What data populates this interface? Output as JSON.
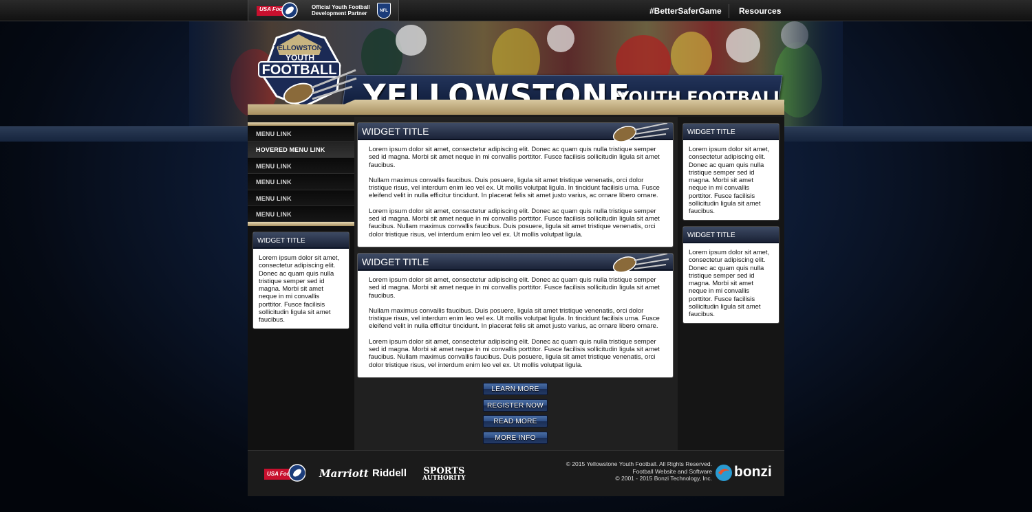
{
  "topbar": {
    "usa_logo_label": "USA Football",
    "partner_line1": "Official Youth Football",
    "partner_line2": "Development Partner",
    "nfl_label": "NFL",
    "hashtag": "#BetterSaferGame",
    "resources": "Resources"
  },
  "header": {
    "logo_top": "YELLOWSTONE",
    "logo_mid": "YOUTH",
    "logo_bottom": "FOOTBALL",
    "title_big": "YELLOWSTONE",
    "title_small": "YOUTH FOOTBALL"
  },
  "menu": {
    "items": [
      "MENU LINK",
      "HOVERED MENU LINK",
      "MENU LINK",
      "MENU LINK",
      "MENU LINK",
      "MENU LINK"
    ]
  },
  "left_widget": {
    "title": "WIDGET TITLE",
    "body": "Lorem ipsum dolor sit amet, consectetur adipiscing elit. Donec ac quam quis nulla tristique semper sed id magna. Morbi sit amet neque in mi convallis porttitor. Fusce facilisis sollicitudin ligula sit amet faucibus."
  },
  "main_widgets": [
    {
      "title": "WIDGET TITLE",
      "p1": "Lorem ipsum dolor sit amet, consectetur adipiscing elit. Donec ac quam quis nulla tristique semper sed id magna. Morbi sit amet neque in mi convallis porttitor. Fusce facilisis sollicitudin ligula sit amet faucibus.",
      "p2": "Nullam maximus convallis faucibus. Duis posuere, ligula sit amet tristique venenatis, orci dolor tristique risus, vel interdum enim leo vel ex. Ut mollis volutpat ligula. In tincidunt facilisis urna. Fusce eleifend velit in nulla efficitur tincidunt. In placerat felis sit amet justo varius, ac ornare libero ornare.",
      "p3": "Lorem ipsum dolor sit amet, consectetur adipiscing elit. Donec ac quam quis nulla tristique semper sed id magna. Morbi sit amet neque in mi convallis porttitor. Fusce facilisis sollicitudin ligula sit amet faucibus. Nullam maximus convallis faucibus. Duis posuere, ligula sit amet tristique venenatis, orci dolor tristique risus, vel interdum enim leo vel ex. Ut mollis volutpat ligula."
    },
    {
      "title": "WIDGET TITLE",
      "p1": "Lorem ipsum dolor sit amet, consectetur adipiscing elit. Donec ac quam quis nulla tristique semper sed id magna. Morbi sit amet neque in mi convallis porttitor. Fusce facilisis sollicitudin ligula sit amet faucibus.",
      "p2": "Nullam maximus convallis faucibus. Duis posuere, ligula sit amet tristique venenatis, orci dolor tristique risus, vel interdum enim leo vel ex. Ut mollis volutpat ligula. In tincidunt facilisis urna. Fusce eleifend velit in nulla efficitur tincidunt. In placerat felis sit amet justo varius, ac ornare libero ornare.",
      "p3": "Lorem ipsum dolor sit amet, consectetur adipiscing elit. Donec ac quam quis nulla tristique semper sed id magna. Morbi sit amet neque in mi convallis porttitor. Fusce facilisis sollicitudin ligula sit amet faucibus. Nullam maximus convallis faucibus. Duis posuere, ligula sit amet tristique venenatis, orci dolor tristique risus, vel interdum enim leo vel ex. Ut mollis volutpat ligula."
    }
  ],
  "buttons": [
    "LEARN MORE",
    "REGISTER NOW",
    "READ MORE",
    "MORE INFO"
  ],
  "right_widgets": [
    {
      "title": "WIDGET TITLE",
      "body": "Lorem ipsum dolor sit amet, consectetur adipiscing elit. Donec ac quam quis nulla tristique semper sed id magna. Morbi sit amet neque in mi convallis porttitor. Fusce facilisis sollicitudin ligula sit amet faucibus."
    },
    {
      "title": "WIDGET TITLE",
      "body": "Lorem ipsum dolor sit amet, consectetur adipiscing elit. Donec ac quam quis nulla tristique semper sed id magna. Morbi sit amet neque in mi convallis porttitor. Fusce facilisis sollicitudin ligula sit amet faucibus."
    }
  ],
  "footer": {
    "sponsors": [
      "Marriott",
      "Riddell",
      "SPORTS",
      "AUTHORITY"
    ],
    "copyright_line1": "© 2015 Yellowstone Youth Football.  All Rights Reserved.",
    "copyright_line2": "Football Website and Software",
    "copyright_line3": "© 2001 - 2015 Bonzi Technology, Inc.",
    "bonzi": "bonzi"
  },
  "colors": {
    "accent_gold": "#c8b480",
    "navy": "#1b2338",
    "button_blue": "#2d4d84"
  }
}
